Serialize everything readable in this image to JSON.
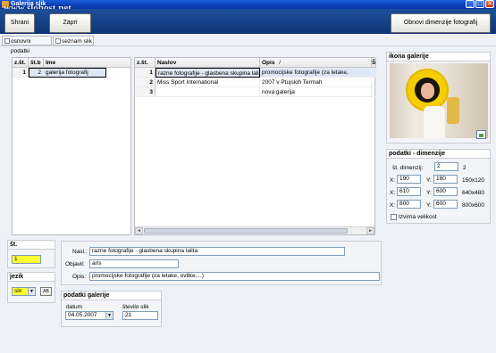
{
  "window": {
    "title": "Galerija slik",
    "watermark": "www.slohost.net",
    "min_glyph": "_",
    "max_glyph": "□",
    "close_glyph": "✕"
  },
  "toolbar": {
    "save_label": "Shrani",
    "save_underline": "S",
    "close_label": "Zapri",
    "close_underline": "Z",
    "refresh_label": "Obnovi dimenzije fotografij"
  },
  "tabs": [
    {
      "label": "osnovni podatki"
    },
    {
      "label": "seznam slik"
    }
  ],
  "gallery_list": {
    "headers": [
      "z.št.",
      "št.b",
      "Ime"
    ],
    "rows": [
      {
        "z": "1",
        "b": "2",
        "name": "galerija fotografij"
      }
    ]
  },
  "photo_grid": {
    "headers": [
      "z.št.",
      "Naslov",
      "Opis",
      "Še"
    ],
    "sort_indicator": "/",
    "rows": [
      {
        "z": "1",
        "naslov": "razne fotografije - glasbena skupina lalita",
        "opis": "promocijske fotografije (za letake,",
        "extra": ""
      },
      {
        "z": "2",
        "naslov": "Miss Sport International",
        "opis": "2007 v Ptujskih Termah",
        "extra": ""
      },
      {
        "z": "3",
        "naslov": "",
        "opis": "nova galerija",
        "extra": ""
      }
    ],
    "scroll_left": "◄",
    "scroll_right": "►"
  },
  "icon_panel": {
    "title": "ikona galerije"
  },
  "dimensions": {
    "title": "podatki - dimenzije",
    "count_label": "št. dimenzij:",
    "count_value": "2",
    "count_note": "2",
    "rows": [
      {
        "x_label": "X:",
        "x": "190",
        "y_label": "Y:",
        "y": "180",
        "size": "150x120"
      },
      {
        "x_label": "X:",
        "x": "610",
        "y_label": "Y:",
        "y": "600",
        "size": "640x480"
      },
      {
        "x_label": "X:",
        "x": "800",
        "y_label": "Y:",
        "y": "600",
        "size": "800x600"
      }
    ],
    "original_size_label": "Izvirna velikost"
  },
  "st_box": {
    "title": "št.",
    "value": "1"
  },
  "jezik_box": {
    "title": "jezik",
    "value": "slo",
    "button_label": "AB"
  },
  "details": {
    "nasl_label": "Nasl.:",
    "nasl_value": "razne fotografije - glasbena skupina lalita",
    "objavil_label": "Objavil:",
    "objavil_value": "aris",
    "opis_label": "Opis:",
    "opis_value": "promocijske fotografije (za letake, ovitke,...)"
  },
  "gallery_info": {
    "title": "podatki galerije",
    "datum_label": "datum",
    "datum_value": "04.05.2007",
    "stevilo_label": "število slik",
    "stevilo_value": "21"
  }
}
